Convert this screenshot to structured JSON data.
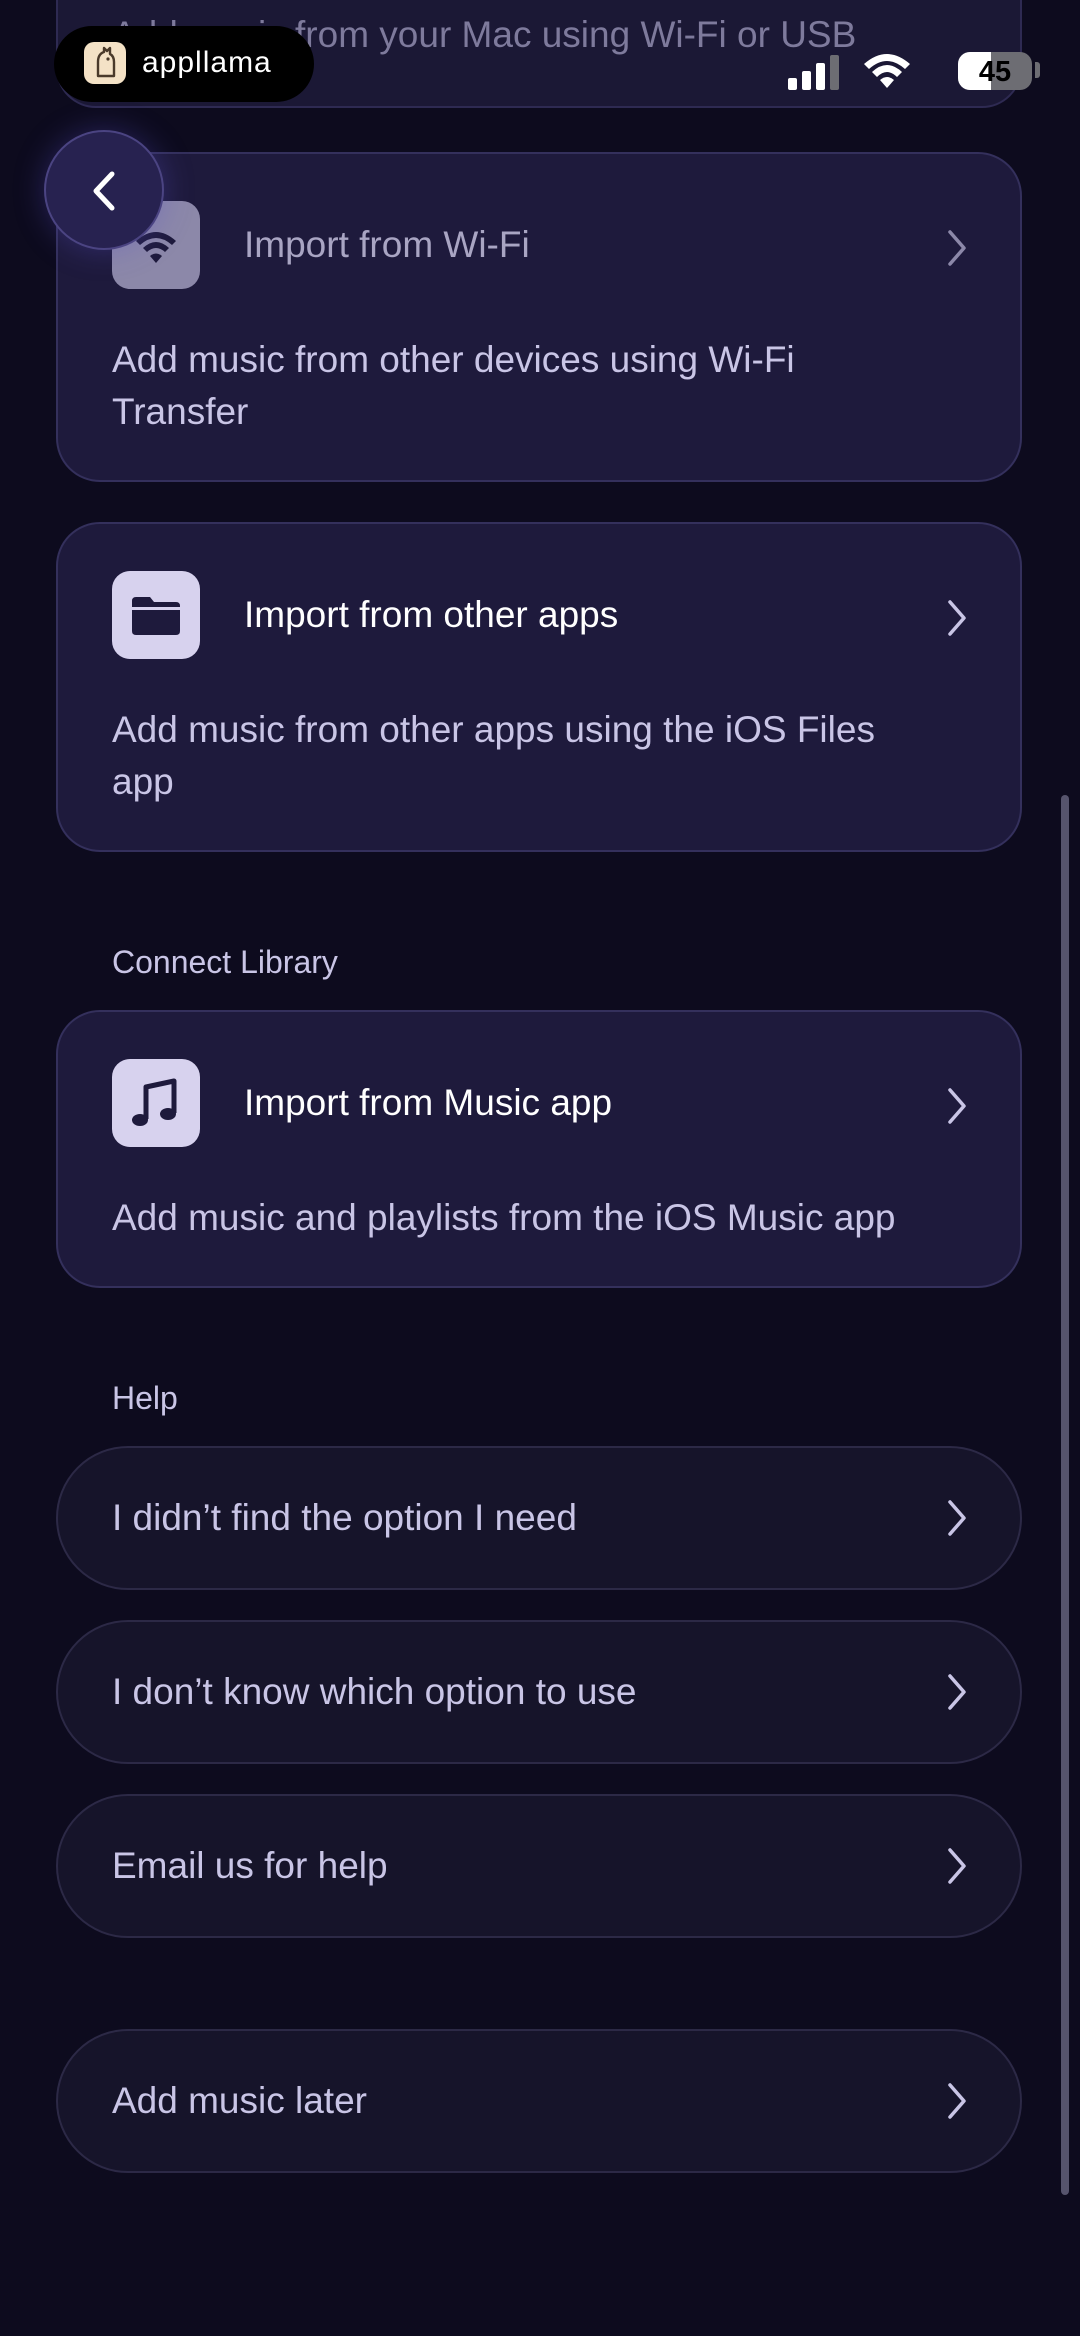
{
  "status_bar": {
    "app_name": "appllama",
    "battery_percent": "45",
    "battery_level": 0.45
  },
  "top_card": {
    "description": "Add music from your Mac using Wi-Fi or USB"
  },
  "cards": [
    {
      "title": "Import from Wi-Fi",
      "description": "Add music from other devices using Wi-Fi Transfer",
      "icon": "wifi-icon"
    },
    {
      "title": "Import from other apps",
      "description": "Add music from other apps using the iOS Files app",
      "icon": "folder-icon"
    }
  ],
  "connect_library": {
    "label": "Connect Library",
    "card": {
      "title": "Import from Music app",
      "description": "Add music and playlists from the iOS Music app",
      "icon": "music-note-icon"
    }
  },
  "help": {
    "label": "Help",
    "items": [
      "I didn’t find the option I need",
      "I don’t know which option to use",
      "Email us for help"
    ]
  },
  "add_later": {
    "label": "Add music later"
  },
  "colors": {
    "background": "#0d0b1e",
    "card": "#1e1a3c",
    "card_border": "#34305c",
    "row": "#16142a",
    "accent_text": "#c9c5e6",
    "icon_tile": "#d7d2ee"
  }
}
